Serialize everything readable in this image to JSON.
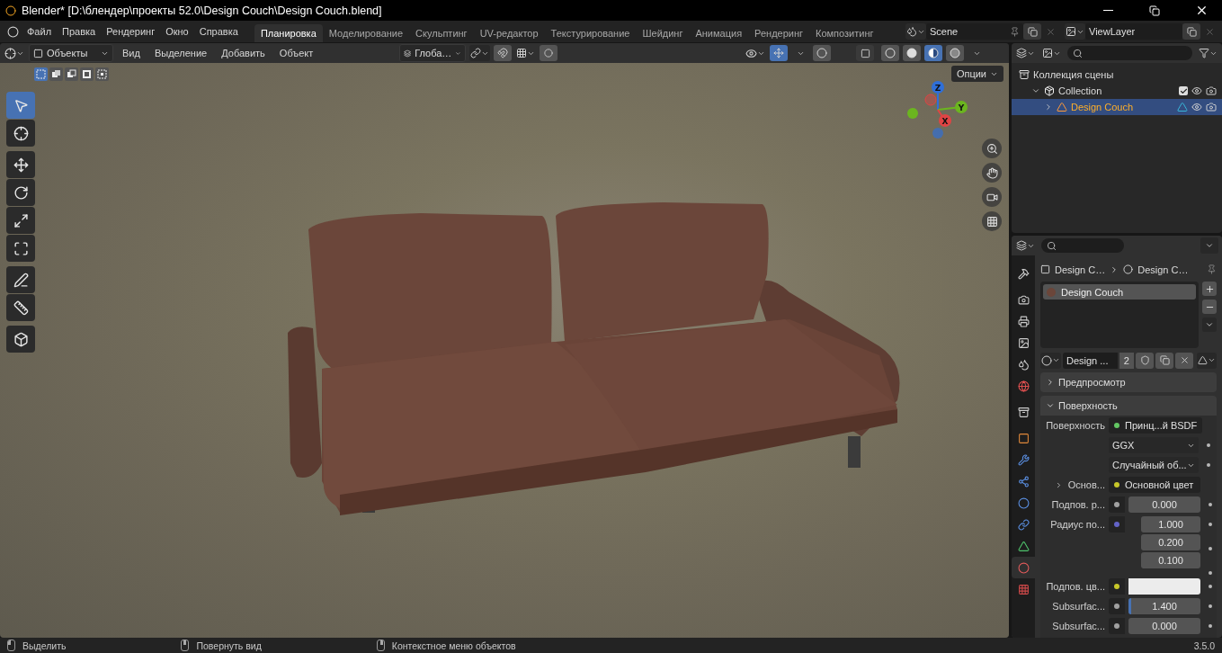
{
  "window": {
    "title": "Blender* [D:\\блендер\\проекты 52.0\\Design Couch\\Design Couch.blend]"
  },
  "menu": [
    "Файл",
    "Правка",
    "Рендеринг",
    "Окно",
    "Справка"
  ],
  "workspaces": [
    {
      "label": "Планировка",
      "selected": true
    },
    {
      "label": "Моделирование",
      "selected": false
    },
    {
      "label": "Скульптинг",
      "selected": false
    },
    {
      "label": "UV-редактор",
      "selected": false
    },
    {
      "label": "Текстурирование",
      "selected": false
    },
    {
      "label": "Шейдинг",
      "selected": false
    },
    {
      "label": "Анимация",
      "selected": false
    },
    {
      "label": "Рендеринг",
      "selected": false
    },
    {
      "label": "Композитинг",
      "selected": false
    }
  ],
  "scene": {
    "name": "Scene"
  },
  "view_layer": {
    "name": "ViewLayer"
  },
  "viewport_header": {
    "mode": "Объекты",
    "menus": [
      "Вид",
      "Выделение",
      "Добавить",
      "Объект"
    ],
    "orientation": "Глоба…",
    "gizmos_on": true
  },
  "shading_modes": [
    {
      "kind": "wireframe",
      "selected": false
    },
    {
      "kind": "solid",
      "selected": false
    },
    {
      "kind": "material",
      "selected": true
    },
    {
      "kind": "rendered",
      "selected": false
    }
  ],
  "select_modes": [
    {
      "kind": "new",
      "selected": true
    },
    {
      "kind": "extend",
      "selected": false
    },
    {
      "kind": "subtract",
      "selected": false
    },
    {
      "kind": "invert",
      "selected": false
    },
    {
      "kind": "intersect",
      "selected": false
    }
  ],
  "options_button": "Опции",
  "toolbar": [
    {
      "kind": "select",
      "selected": true
    },
    {
      "kind": "cursor",
      "selected": false
    },
    {
      "kind": "move",
      "selected": false
    },
    {
      "kind": "rotate",
      "selected": false
    },
    {
      "kind": "scale",
      "selected": false
    },
    {
      "kind": "transform",
      "selected": false
    },
    {
      "kind": "annotate",
      "selected": false
    },
    {
      "kind": "measure",
      "selected": false
    },
    {
      "kind": "add_cube",
      "selected": false
    }
  ],
  "gizmo": {
    "axes": [
      "Z",
      "Y",
      "X"
    ]
  },
  "outliner": {
    "items": [
      {
        "label": "Коллекция сцены",
        "kind": "scene",
        "children": [
          {
            "label": "Collection",
            "kind": "collection",
            "expanded": true,
            "checked": true,
            "selected": false,
            "children": [
              {
                "label": "Design Couch",
                "kind": "mesh",
                "expanded": false,
                "selected": true
              }
            ]
          }
        ]
      }
    ]
  },
  "properties": {
    "tabs": [
      {
        "kind": "tool",
        "selected": false
      },
      {
        "kind": "render",
        "selected": false
      },
      {
        "kind": "output",
        "selected": false
      },
      {
        "kind": "view_layer",
        "selected": false
      },
      {
        "kind": "scene",
        "selected": false
      },
      {
        "kind": "world",
        "selected": false
      },
      {
        "kind": "collection",
        "selected": false
      },
      {
        "kind": "object",
        "selected": false
      },
      {
        "kind": "modifiers",
        "selected": false
      },
      {
        "kind": "particles",
        "selected": false
      },
      {
        "kind": "physics",
        "selected": false
      },
      {
        "kind": "constraints",
        "selected": false
      },
      {
        "kind": "data",
        "selected": false
      },
      {
        "kind": "material",
        "selected": true
      },
      {
        "kind": "texture",
        "selected": false
      }
    ],
    "breadcrumb": [
      "Design C…",
      "Design C…"
    ],
    "slots": [
      {
        "label": "Design Couch",
        "selected": true
      }
    ],
    "material_name": "Design ...",
    "users": "2",
    "panels": [
      {
        "label": "Предпросмотр",
        "expanded": false
      },
      {
        "label": "Поверхность",
        "expanded": true
      }
    ],
    "rows": [
      {
        "kind": "link",
        "label": "Поверхность",
        "value": "Принц...й BSDF",
        "socket": {
          "color": "#63c763"
        }
      },
      {
        "kind": "dropdown",
        "value": "GGX"
      },
      {
        "kind": "dropdown",
        "value": "Случайный об..."
      },
      {
        "kind": "link",
        "label": "Основ...",
        "value": "Основной цвет",
        "socket": {
          "color": "#c7c729"
        },
        "expanded": false
      },
      {
        "kind": "number",
        "label": "Подпов. р...",
        "values": [
          "0.000"
        ],
        "socket": {
          "color": "#a1a1a1"
        }
      },
      {
        "kind": "number",
        "label": "Радиус по...",
        "values": [
          "1.000",
          "0.200",
          "0.100"
        ],
        "socket": {
          "color": "#6363c7"
        }
      },
      {
        "kind": "color",
        "label": "Подпов. цв...",
        "swatch": {
          "color": "#ececec"
        },
        "socket": {
          "color": "#c7c729"
        }
      },
      {
        "kind": "slider",
        "label": "Subsurfac...",
        "values": [
          "1.400"
        ],
        "level": 0.04,
        "socket": {
          "color": "#a1a1a1"
        }
      },
      {
        "kind": "number",
        "label": "Subsurfac...",
        "values": [
          "0.000"
        ],
        "socket": {
          "color": "#a1a1a1"
        }
      }
    ]
  },
  "status_bar": {
    "hints": [
      {
        "kind": "left",
        "label": "Выделить"
      },
      {
        "kind": "middle",
        "label": "Повернуть вид"
      },
      {
        "kind": "right",
        "label": "Контекстное меню объектов"
      }
    ],
    "version": "3.5.0"
  }
}
